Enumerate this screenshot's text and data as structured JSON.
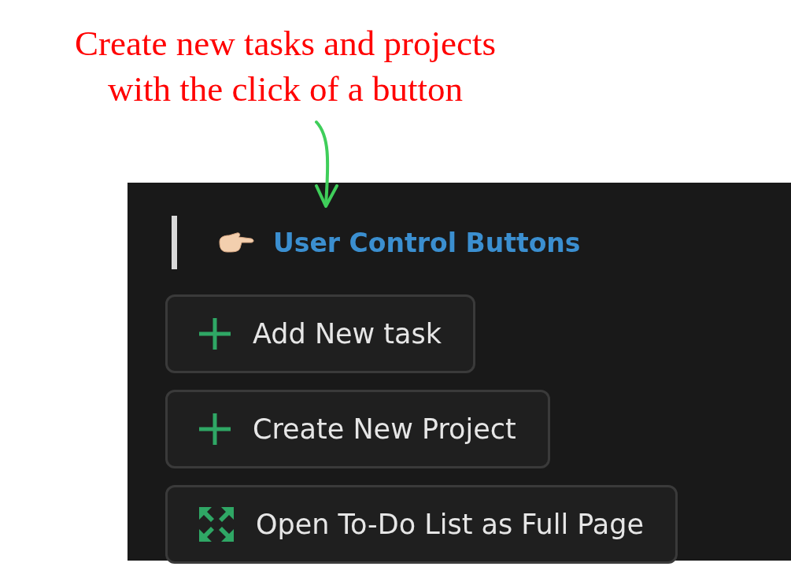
{
  "annotation": {
    "lines": [
      "Create new tasks and projects",
      "with the click of a button"
    ]
  },
  "panel": {
    "heading": "User Control Buttons",
    "buttons": [
      {
        "label": "Add New task",
        "kind": "plus"
      },
      {
        "label": "Create New Project",
        "kind": "plus"
      },
      {
        "label": "Open To-Do List as Full Page",
        "kind": "expand"
      }
    ]
  }
}
